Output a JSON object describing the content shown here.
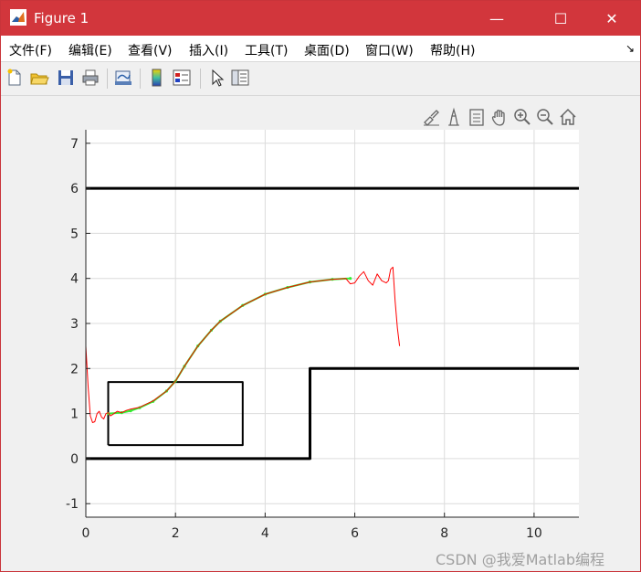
{
  "window": {
    "title": "Figure 1",
    "minimize_label": "—",
    "maximize_label": "☐",
    "close_label": "✕"
  },
  "menu": {
    "items": [
      {
        "label": "文件(F)"
      },
      {
        "label": "编辑(E)"
      },
      {
        "label": "查看(V)"
      },
      {
        "label": "插入(I)"
      },
      {
        "label": "工具(T)"
      },
      {
        "label": "桌面(D)"
      },
      {
        "label": "窗口(W)"
      },
      {
        "label": "帮助(H)"
      }
    ],
    "overflow_icon": "↘"
  },
  "toolbar": {
    "buttons": [
      "new-figure-icon",
      "open-file-icon",
      "save-icon",
      "print-icon",
      "link-plot-icon",
      "colorbar-icon",
      "legend-icon",
      "edit-plot-icon",
      "property-inspector-icon"
    ]
  },
  "axes_toolbar": {
    "buttons": [
      "brush-icon",
      "data-tips-icon",
      "export-icon",
      "pan-icon",
      "zoom-in-icon",
      "zoom-out-icon",
      "home-icon"
    ]
  },
  "colors": {
    "titlebar": "#d2363c",
    "grid": "#dcdcdc",
    "boundary": "#000000",
    "trajectory_red": "#ff0000",
    "trajectory_green": "#33ee33"
  },
  "chart_data": {
    "type": "line",
    "xlim": [
      0,
      11
    ],
    "ylim": [
      -1.3,
      7.3
    ],
    "x_ticks": [
      "0",
      "2",
      "4",
      "6",
      "8",
      "10"
    ],
    "x_tick_values": [
      0,
      2,
      4,
      6,
      8,
      10
    ],
    "y_ticks": [
      "-1",
      "0",
      "1",
      "2",
      "3",
      "4",
      "5",
      "6",
      "7"
    ],
    "y_tick_values": [
      -1,
      0,
      1,
      2,
      3,
      4,
      5,
      6,
      7
    ],
    "grid": true,
    "series": [
      {
        "style": "black-thick",
        "x": [
          0,
          11
        ],
        "y": [
          6,
          6
        ]
      },
      {
        "style": "black-thick",
        "x": [
          0,
          5,
          5,
          11
        ],
        "y": [
          0,
          0,
          2,
          2
        ]
      },
      {
        "style": "black-thin",
        "x": [
          0.5,
          3.5,
          3.5,
          0.5,
          0.5
        ],
        "y": [
          0.3,
          0.3,
          1.7,
          1.7,
          0.3
        ]
      },
      {
        "style": "green-ref",
        "x": [
          0.5,
          0.8,
          1.0,
          1.2,
          1.5,
          1.8,
          2.0,
          2.2,
          2.5,
          2.8,
          3.0,
          3.5,
          4.0,
          4.5,
          5.0,
          5.5,
          5.9
        ],
        "y": [
          1.0,
          1.02,
          1.06,
          1.13,
          1.27,
          1.5,
          1.72,
          2.05,
          2.5,
          2.85,
          3.05,
          3.4,
          3.65,
          3.8,
          3.92,
          3.98,
          4.0
        ]
      },
      {
        "style": "red-actual",
        "x": [
          0.0,
          0.05,
          0.1,
          0.15,
          0.2,
          0.25,
          0.3,
          0.35,
          0.4,
          0.45,
          0.5,
          0.55,
          0.6,
          0.7,
          0.8,
          0.9,
          1.0,
          1.2,
          1.5,
          1.8,
          2.0,
          2.2,
          2.5,
          2.8,
          3.0,
          3.5,
          4.0,
          4.5,
          5.0,
          5.5,
          5.8,
          5.9,
          6.0,
          6.1,
          6.2,
          6.3,
          6.4,
          6.5,
          6.6,
          6.7,
          6.75,
          6.8,
          6.85,
          6.9,
          6.95,
          7.0
        ],
        "y": [
          2.5,
          1.6,
          0.95,
          0.8,
          0.82,
          1.0,
          1.05,
          0.92,
          0.88,
          1.0,
          1.02,
          0.95,
          0.98,
          1.05,
          1.02,
          1.07,
          1.1,
          1.14,
          1.28,
          1.5,
          1.72,
          2.05,
          2.5,
          2.85,
          3.05,
          3.4,
          3.65,
          3.8,
          3.92,
          3.98,
          4.0,
          3.88,
          3.9,
          4.05,
          4.15,
          3.95,
          3.85,
          4.1,
          3.95,
          3.9,
          3.95,
          4.2,
          4.25,
          3.5,
          2.9,
          2.5
        ]
      }
    ]
  },
  "watermark": "CSDN @我爱Matlab编程"
}
